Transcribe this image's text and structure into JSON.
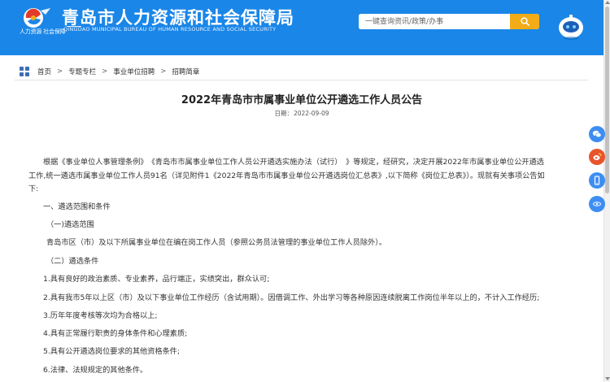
{
  "header": {
    "logo_caption": "人力资源 社会保障",
    "title": "青岛市人力资源和社会保障局",
    "subtitle_en": "QINGDAO MUNICIPAL BUREAU OF HUMAN RESOURCE AND SOCIAL SECURITY",
    "search_placeholder": "一键查询资讯/政策/办事",
    "brand_color": "#1a86e8",
    "search_button_color": "#f3ac18"
  },
  "breadcrumb": [
    "首页",
    "专题专栏",
    "事业单位招聘",
    "招聘简章"
  ],
  "article": {
    "title": "2022年青岛市市属事业单位公开遴选工作人员公告",
    "date_label": "日期：",
    "date": "2022-09-09",
    "intro_line1": "根据《事业单位人事管理条例》　《青岛市市属事业单位工作人员公开遴选实施办法（试行）　》等规定，经研究，决定开展2022年市属事业单位公开遴选",
    "intro_line2": "工作,统一遴选市属事业单位工作人员91名（详见附件1《2022年青岛市市属事业单位公开遴选岗位汇总表》,以下简称《岗位汇总表》）。现就有关事项公告如",
    "intro_line3": "下:",
    "section1": "一、遴选范围和条件",
    "sub1": "（一)遴选范围",
    "scope": "青岛市区（市）及以下所属事业单位在编在岗工作人员（参照公务员法管理的事业单位工作人员除外）。",
    "sub2": "（二）遴选条件",
    "conditions": [
      "1.具有良好的政治素质、专业素养，品行端正，实绩突出，群众认可;",
      "2.具有我市5年以上区（市）及以下事业单位工作经历（含试用期）。因借调工作、外出学习等各种原因连续脱离工作岗位半年以上的，不计入工作经历;",
      "3.历年年度考核等次均为合格以上;",
      "4.具有正常履行职责的身体条件和心理素质;",
      "5.具有公开遴选岗位要求的其他资格条件;",
      "6.法律、法规规定的其他条件。"
    ]
  },
  "side_tools": [
    "wechat-icon",
    "weibo-icon",
    "mobile-icon",
    "top-icon"
  ]
}
